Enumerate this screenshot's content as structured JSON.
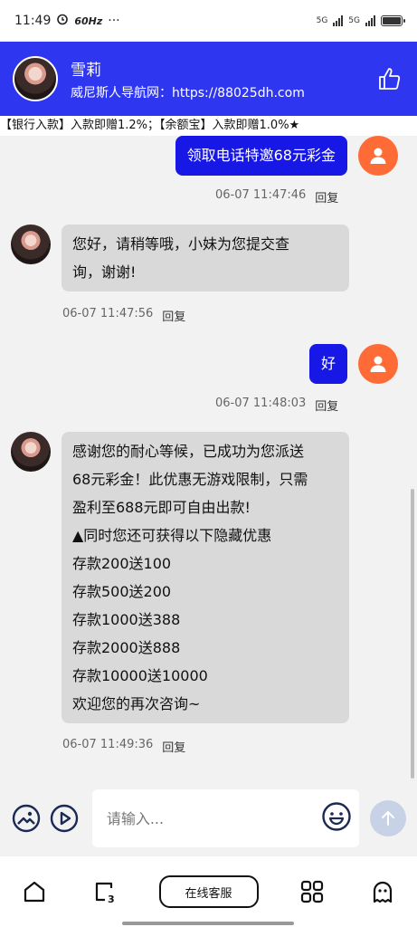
{
  "status_bar": {
    "time": "11:49",
    "hz": "60Hz",
    "dots": "···",
    "signal1": "5G",
    "signal2": "5G"
  },
  "header": {
    "name": "雪莉",
    "subtitle": "威尼斯人导航网：https://88025dh.com",
    "brand_color": "#2f36f0"
  },
  "marquee": {
    "text": "【银行入款】入款即赠1.2%；【余额宝】入款即赠1.0%★"
  },
  "messages": [
    {
      "side": "out",
      "text": "领取电话特邀68元彩金",
      "time": "06-07 11:47:46",
      "reply": "回复"
    },
    {
      "side": "in",
      "lines": [
        "您好，请稍等哦，小妹为您提交查",
        "询，谢谢!"
      ],
      "time": "06-07 11:47:56",
      "reply": "回复"
    },
    {
      "side": "out",
      "text": "好",
      "time": "06-07 11:48:03",
      "reply": "回复"
    },
    {
      "side": "in",
      "lines": [
        "感谢您的耐心等候，已成功为您派送",
        "68元彩金！此优惠无游戏限制，只需",
        "盈利至688元即可自由出款!",
        "▲同时您还可获得以下隐藏优惠",
        "存款200送100",
        "存款500送200",
        "存款1000送388",
        "存款2000送888",
        "存款10000送10000",
        "欢迎您的再次咨询~"
      ],
      "time": "06-07 11:49:36",
      "reply": "回复"
    }
  ],
  "input": {
    "placeholder": "请输入..."
  },
  "bottom_nav": {
    "main_label": "在线客服"
  },
  "colors": {
    "out_bubble": "#1717e6",
    "in_bubble": "#d9d9d9",
    "user_avatar": "#ff6b36",
    "send_button": "#c7d2e6"
  }
}
